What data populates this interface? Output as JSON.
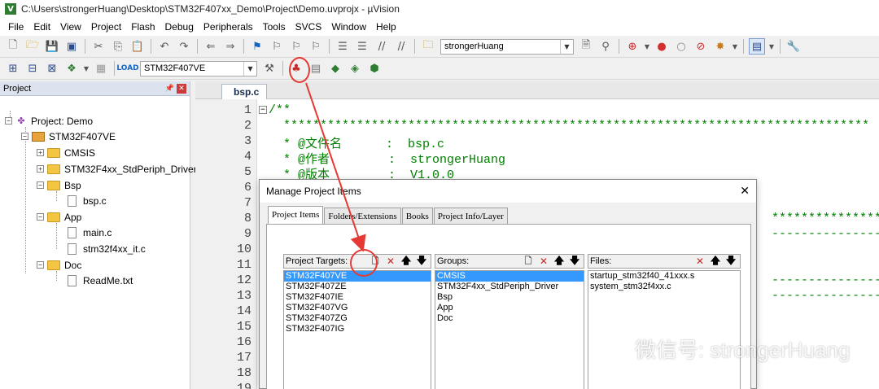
{
  "window": {
    "title": "C:\\Users\\strongerHuang\\Desktop\\STM32F407xx_Demo\\Project\\Demo.uvprojx - µVision"
  },
  "menu": [
    "File",
    "Edit",
    "View",
    "Project",
    "Flash",
    "Debug",
    "Peripherals",
    "Tools",
    "SVCS",
    "Window",
    "Help"
  ],
  "toolbar1": {
    "find_value": "strongerHuang"
  },
  "toolbar2": {
    "target_value": "STM32F407VE"
  },
  "project_panel": {
    "title": "Project",
    "tree": {
      "root": "Project: Demo",
      "target": "STM32F407VE",
      "groups": [
        {
          "name": "CMSIS",
          "expanded": false,
          "files": []
        },
        {
          "name": "STM32F4xx_StdPeriph_Driver",
          "expanded": false,
          "files": []
        },
        {
          "name": "Bsp",
          "expanded": true,
          "files": [
            "bsp.c"
          ]
        },
        {
          "name": "App",
          "expanded": true,
          "files": [
            "main.c",
            "stm32f4xx_it.c"
          ]
        },
        {
          "name": "Doc",
          "expanded": true,
          "files": [
            "ReadMe.txt"
          ]
        }
      ]
    }
  },
  "editor": {
    "tab": "bsp.c",
    "line_numbers": [
      "1",
      "2",
      "3",
      "4",
      "5",
      "6",
      "7",
      "8",
      "9",
      "10",
      "11",
      "12",
      "13",
      "14",
      "15",
      "16",
      "17",
      "18",
      "19"
    ],
    "code": {
      "l1": "/**",
      "l2": "  ********************************************************************************",
      "l3": "  * @文件名      :  bsp.c",
      "l4": "  * @作者        :  strongerHuang",
      "l5": "  * @版本        :  V1.0.0",
      "l8": "  ****************",
      "l9": "  ----------------",
      "l12": "  ----------------",
      "l13": "  ----------------"
    }
  },
  "dialog": {
    "title": "Manage Project Items",
    "tabs": [
      "Project Items",
      "Folders/Extensions",
      "Books",
      "Project Info/Layer"
    ],
    "targets": {
      "label": "Project Targets:",
      "items": [
        "STM32F407VE",
        "STM32F407ZE",
        "STM32F407IE",
        "STM32F407VG",
        "STM32F407ZG",
        "STM32F407IG"
      ]
    },
    "groups": {
      "label": "Groups:",
      "items": [
        "CMSIS",
        "STM32F4xx_StdPeriph_Driver",
        "Bsp",
        "App",
        "Doc"
      ]
    },
    "files": {
      "label": "Files:",
      "items": [
        "startup_stm32f40_41xxx.s",
        "system_stm32f4xx.c"
      ]
    }
  },
  "watermark": {
    "text": "微信号: strongerHuang"
  },
  "colors": {
    "annotation": "#e53935",
    "selection": "#3399ff",
    "comment": "#008000"
  }
}
